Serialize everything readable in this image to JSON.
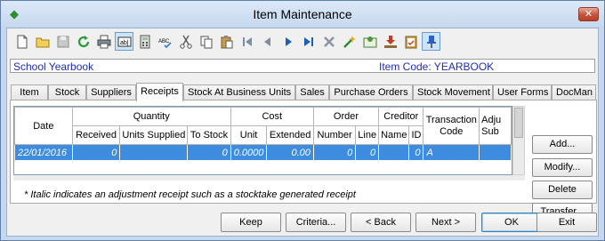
{
  "window": {
    "title": "Item Maintenance",
    "close_label": "✕"
  },
  "toolbar": {
    "icons": [
      {
        "name": "new-icon"
      },
      {
        "name": "open-folder-icon"
      },
      {
        "name": "save-icon"
      },
      {
        "name": "refresh-icon"
      },
      {
        "name": "print-icon"
      },
      {
        "name": "field-icon"
      },
      {
        "name": "calculator-icon"
      },
      {
        "name": "spell-check-icon"
      },
      {
        "name": "cut-icon"
      },
      {
        "name": "copy-icon"
      },
      {
        "name": "paste-icon"
      },
      {
        "name": "first-record-icon"
      },
      {
        "name": "previous-record-icon"
      },
      {
        "name": "next-record-icon"
      },
      {
        "name": "last-record-icon"
      },
      {
        "name": "delete-icon"
      },
      {
        "name": "wizard-icon"
      },
      {
        "name": "certificate-icon"
      },
      {
        "name": "import-icon"
      },
      {
        "name": "clipboard-check-icon"
      },
      {
        "name": "pin-icon"
      }
    ],
    "field_glyph": "ab|",
    "spell_glyph": "ABC"
  },
  "header": {
    "item_name": "School Yearbook",
    "item_code": "Item Code: YEARBOOK"
  },
  "tabs": [
    {
      "label": "Item",
      "active": false
    },
    {
      "label": "Stock",
      "active": false
    },
    {
      "label": "Suppliers",
      "active": false
    },
    {
      "label": "Receipts",
      "active": true
    },
    {
      "label": "Stock At Business Units",
      "active": false
    },
    {
      "label": "Sales",
      "active": false
    },
    {
      "label": "Purchase Orders",
      "active": false
    },
    {
      "label": "Stock Movement",
      "active": false
    },
    {
      "label": "User Forms",
      "active": false
    },
    {
      "label": "DocMan",
      "active": false
    }
  ],
  "grid": {
    "group_headers": {
      "date": "Date",
      "quantity": "Quantity",
      "cost": "Cost",
      "order": "Order",
      "creditor": "Creditor",
      "transaction_code": "Transaction Code",
      "adjustment": "Adju Sub"
    },
    "sub_headers": {
      "received": "Received",
      "units_supplied": "Units Supplied",
      "to_stock": "To Stock",
      "unit": "Unit",
      "extended": "Extended",
      "number": "Number",
      "line": "Line",
      "name": "Name",
      "id": "ID"
    },
    "rows": [
      {
        "date": "22/01/2016",
        "received": "0",
        "units_supplied": "",
        "to_stock": "0",
        "unit": "0.0000",
        "extended": "0.00",
        "number": "0",
        "line": "0",
        "name": "",
        "id": "0",
        "transaction_code": "A",
        "adjustment": ""
      }
    ]
  },
  "note": "* Italic indicates an adjustment receipt such as a stocktake generated receipt",
  "side_buttons": {
    "add": "Add...",
    "modify": "Modify...",
    "delete": "Delete",
    "transfer": "Transfer..."
  },
  "bottom_buttons": {
    "keep": "Keep",
    "criteria": "Criteria...",
    "back": "< Back",
    "next": "Next >",
    "ok": "OK",
    "exit": "Exit"
  },
  "colors": {
    "selection": "#3d8ce0",
    "header_text": "#1f2db5",
    "window_frame": "#c6d8ef"
  }
}
